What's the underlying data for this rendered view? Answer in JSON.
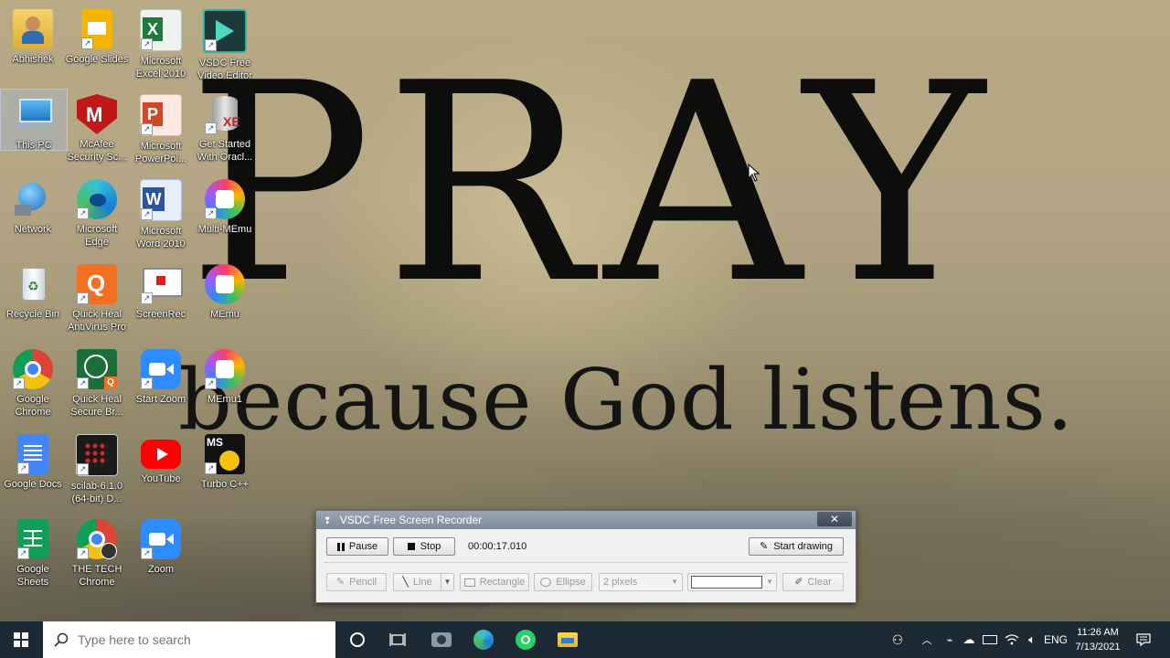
{
  "desktop": {
    "wallpaper_text": {
      "line1": "PRAY",
      "line2": "because God listens."
    },
    "icons": [
      {
        "label": "Abhishek",
        "icon": "user-folder-icon"
      },
      {
        "label": "Google Slides",
        "icon": "google-slides-icon"
      },
      {
        "label": "Microsoft Excel 2010",
        "icon": "excel-icon"
      },
      {
        "label": "VSDC Free Video Editor",
        "icon": "vsdc-editor-icon"
      },
      {
        "label": "This PC",
        "icon": "computer-icon"
      },
      {
        "label": "McAfee Security Sc...",
        "icon": "mcafee-icon"
      },
      {
        "label": "Microsoft PowerPoi...",
        "icon": "powerpoint-icon"
      },
      {
        "label": "Get Started With Oracl...",
        "icon": "oracle-icon"
      },
      {
        "label": "Network",
        "icon": "network-icon"
      },
      {
        "label": "Microsoft Edge",
        "icon": "edge-icon"
      },
      {
        "label": "Microsoft Word 2010",
        "icon": "word-icon"
      },
      {
        "label": "Multi-MEmu",
        "icon": "memu-icon"
      },
      {
        "label": "Recycle Bin",
        "icon": "recycle-bin-icon"
      },
      {
        "label": "Quick Heal AntiVirus Pro",
        "icon": "quickheal-icon"
      },
      {
        "label": "ScreenRec",
        "icon": "screenrec-icon"
      },
      {
        "label": "MEmu",
        "icon": "memu-icon"
      },
      {
        "label": "Google Chrome",
        "icon": "chrome-icon"
      },
      {
        "label": "Quick Heal Secure Br...",
        "icon": "quickheal-browser-icon"
      },
      {
        "label": "Start Zoom",
        "icon": "zoom-icon"
      },
      {
        "label": "MEmu1",
        "icon": "memu-icon"
      },
      {
        "label": "Google Docs",
        "icon": "google-docs-icon"
      },
      {
        "label": "scilab-6.1.0 (64-bit) D...",
        "icon": "scilab-icon"
      },
      {
        "label": "YouTube",
        "icon": "youtube-icon"
      },
      {
        "label": "Turbo C++",
        "icon": "turbo-cpp-icon"
      },
      {
        "label": "Google Sheets",
        "icon": "google-sheets-icon"
      },
      {
        "label": "THE TECH Chrome",
        "icon": "chrome-profile-icon"
      },
      {
        "label": "Zoom",
        "icon": "zoom-icon"
      }
    ]
  },
  "recorder": {
    "title": "VSDC Free Screen Recorder",
    "close_label": "✕",
    "pause_label": "Pause",
    "stop_label": "Stop",
    "timer": "00:00:17.010",
    "start_drawing_label": "Start drawing",
    "pencil_label": "Pencil",
    "line_label": "Line",
    "rectangle_label": "Rectangle",
    "ellipse_label": "Ellipse",
    "stroke_size": "2 pixels",
    "clear_label": "Clear"
  },
  "taskbar": {
    "search_placeholder": "Type here to search",
    "language": "ENG",
    "time": "11:26 AM",
    "date": "7/13/2021"
  }
}
